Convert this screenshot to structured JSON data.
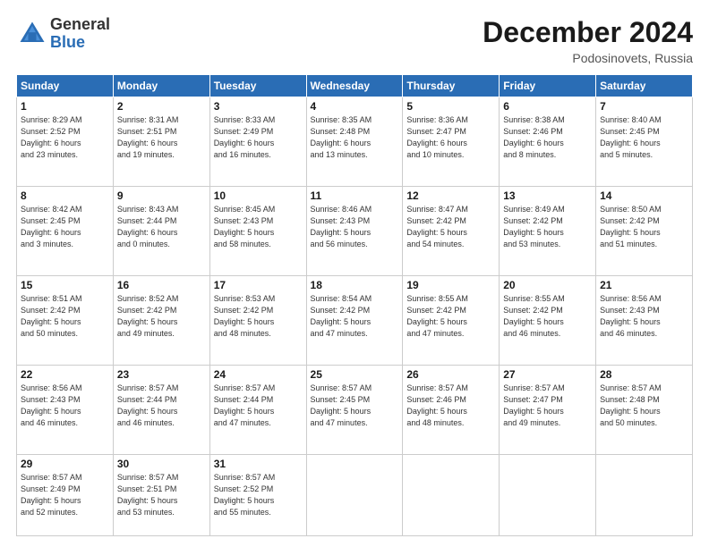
{
  "header": {
    "logo_general": "General",
    "logo_blue": "Blue",
    "title": "December 2024",
    "location": "Podosinovets, Russia"
  },
  "weekdays": [
    "Sunday",
    "Monday",
    "Tuesday",
    "Wednesday",
    "Thursday",
    "Friday",
    "Saturday"
  ],
  "weeks": [
    [
      {
        "day": "1",
        "info": "Sunrise: 8:29 AM\nSunset: 2:52 PM\nDaylight: 6 hours\nand 23 minutes."
      },
      {
        "day": "2",
        "info": "Sunrise: 8:31 AM\nSunset: 2:51 PM\nDaylight: 6 hours\nand 19 minutes."
      },
      {
        "day": "3",
        "info": "Sunrise: 8:33 AM\nSunset: 2:49 PM\nDaylight: 6 hours\nand 16 minutes."
      },
      {
        "day": "4",
        "info": "Sunrise: 8:35 AM\nSunset: 2:48 PM\nDaylight: 6 hours\nand 13 minutes."
      },
      {
        "day": "5",
        "info": "Sunrise: 8:36 AM\nSunset: 2:47 PM\nDaylight: 6 hours\nand 10 minutes."
      },
      {
        "day": "6",
        "info": "Sunrise: 8:38 AM\nSunset: 2:46 PM\nDaylight: 6 hours\nand 8 minutes."
      },
      {
        "day": "7",
        "info": "Sunrise: 8:40 AM\nSunset: 2:45 PM\nDaylight: 6 hours\nand 5 minutes."
      }
    ],
    [
      {
        "day": "8",
        "info": "Sunrise: 8:42 AM\nSunset: 2:45 PM\nDaylight: 6 hours\nand 3 minutes."
      },
      {
        "day": "9",
        "info": "Sunrise: 8:43 AM\nSunset: 2:44 PM\nDaylight: 6 hours\nand 0 minutes."
      },
      {
        "day": "10",
        "info": "Sunrise: 8:45 AM\nSunset: 2:43 PM\nDaylight: 5 hours\nand 58 minutes."
      },
      {
        "day": "11",
        "info": "Sunrise: 8:46 AM\nSunset: 2:43 PM\nDaylight: 5 hours\nand 56 minutes."
      },
      {
        "day": "12",
        "info": "Sunrise: 8:47 AM\nSunset: 2:42 PM\nDaylight: 5 hours\nand 54 minutes."
      },
      {
        "day": "13",
        "info": "Sunrise: 8:49 AM\nSunset: 2:42 PM\nDaylight: 5 hours\nand 53 minutes."
      },
      {
        "day": "14",
        "info": "Sunrise: 8:50 AM\nSunset: 2:42 PM\nDaylight: 5 hours\nand 51 minutes."
      }
    ],
    [
      {
        "day": "15",
        "info": "Sunrise: 8:51 AM\nSunset: 2:42 PM\nDaylight: 5 hours\nand 50 minutes."
      },
      {
        "day": "16",
        "info": "Sunrise: 8:52 AM\nSunset: 2:42 PM\nDaylight: 5 hours\nand 49 minutes."
      },
      {
        "day": "17",
        "info": "Sunrise: 8:53 AM\nSunset: 2:42 PM\nDaylight: 5 hours\nand 48 minutes."
      },
      {
        "day": "18",
        "info": "Sunrise: 8:54 AM\nSunset: 2:42 PM\nDaylight: 5 hours\nand 47 minutes."
      },
      {
        "day": "19",
        "info": "Sunrise: 8:55 AM\nSunset: 2:42 PM\nDaylight: 5 hours\nand 47 minutes."
      },
      {
        "day": "20",
        "info": "Sunrise: 8:55 AM\nSunset: 2:42 PM\nDaylight: 5 hours\nand 46 minutes."
      },
      {
        "day": "21",
        "info": "Sunrise: 8:56 AM\nSunset: 2:43 PM\nDaylight: 5 hours\nand 46 minutes."
      }
    ],
    [
      {
        "day": "22",
        "info": "Sunrise: 8:56 AM\nSunset: 2:43 PM\nDaylight: 5 hours\nand 46 minutes."
      },
      {
        "day": "23",
        "info": "Sunrise: 8:57 AM\nSunset: 2:44 PM\nDaylight: 5 hours\nand 46 minutes."
      },
      {
        "day": "24",
        "info": "Sunrise: 8:57 AM\nSunset: 2:44 PM\nDaylight: 5 hours\nand 47 minutes."
      },
      {
        "day": "25",
        "info": "Sunrise: 8:57 AM\nSunset: 2:45 PM\nDaylight: 5 hours\nand 47 minutes."
      },
      {
        "day": "26",
        "info": "Sunrise: 8:57 AM\nSunset: 2:46 PM\nDaylight: 5 hours\nand 48 minutes."
      },
      {
        "day": "27",
        "info": "Sunrise: 8:57 AM\nSunset: 2:47 PM\nDaylight: 5 hours\nand 49 minutes."
      },
      {
        "day": "28",
        "info": "Sunrise: 8:57 AM\nSunset: 2:48 PM\nDaylight: 5 hours\nand 50 minutes."
      }
    ],
    [
      {
        "day": "29",
        "info": "Sunrise: 8:57 AM\nSunset: 2:49 PM\nDaylight: 5 hours\nand 52 minutes."
      },
      {
        "day": "30",
        "info": "Sunrise: 8:57 AM\nSunset: 2:51 PM\nDaylight: 5 hours\nand 53 minutes."
      },
      {
        "day": "31",
        "info": "Sunrise: 8:57 AM\nSunset: 2:52 PM\nDaylight: 5 hours\nand 55 minutes."
      },
      {
        "day": "",
        "info": ""
      },
      {
        "day": "",
        "info": ""
      },
      {
        "day": "",
        "info": ""
      },
      {
        "day": "",
        "info": ""
      }
    ]
  ]
}
